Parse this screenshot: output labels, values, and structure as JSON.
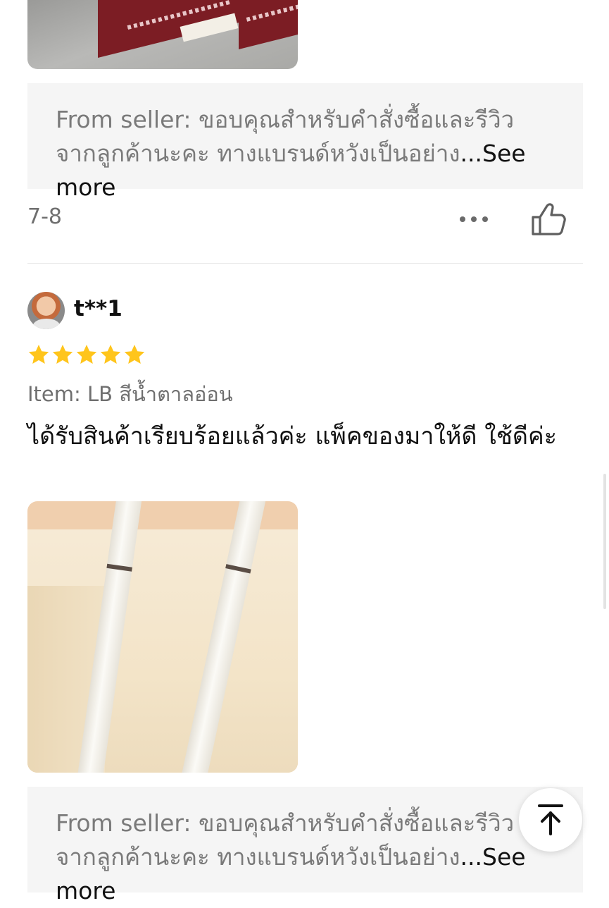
{
  "previous_review": {
    "seller_reply_prefix": "From seller:",
    "seller_reply_text": " ขอบคุณสำหรับคำสั่งซื้อและรีวิวจากลูกค้านะคะ ทางแบรนด์หวังเป็นอย่าง",
    "see_more_label": "...See more",
    "date": "7-8"
  },
  "review": {
    "username": "t**1",
    "rating": 5,
    "item_variant": "Item: LB สีน้ำตาลอ่อน",
    "text": "ได้รับสินค้าเรียบร้อยแล้วค่ะ แพ็คของมาให้ดี ใช้ดีค่ะ",
    "seller_reply_prefix": "From seller:",
    "seller_reply_text": " ขอบคุณสำหรับคำสั่งซื้อและรีวิวจากลูกค้านะคะ ทางแบรนด์หวังเป็นอย่าง",
    "see_more_label": "...See more"
  },
  "colors": {
    "star": "#FFC51C",
    "muted_text": "#7a7a7a",
    "reply_background": "#f5f5f5"
  },
  "icons": {
    "more": "more-horizontal-icon",
    "like": "thumbs-up-icon",
    "scroll_top": "arrow-up-to-top-icon",
    "star": "star-icon"
  }
}
